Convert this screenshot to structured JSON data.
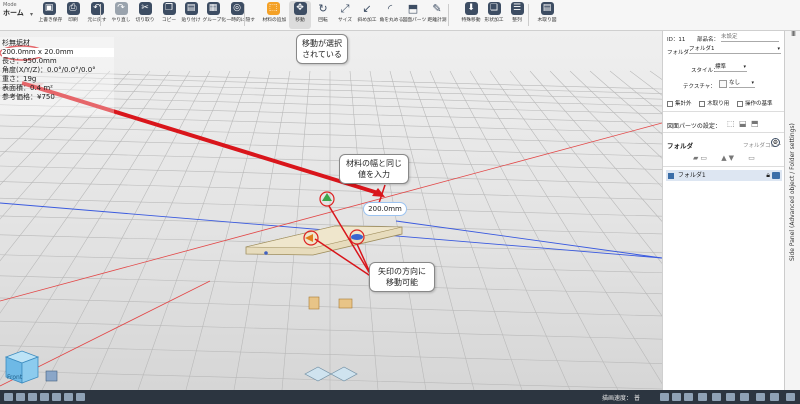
{
  "mode": {
    "caption": "Mode",
    "value": "ホーム"
  },
  "toolbar": {
    "items": [
      {
        "label": "上書き保存",
        "icon": "save-icon",
        "glyph": "▣"
      },
      {
        "label": "印刷",
        "icon": "print-icon",
        "glyph": "⎙"
      },
      {
        "label": "元に戻す",
        "icon": "undo-icon",
        "glyph": "↶"
      },
      {
        "label": "やり直し",
        "icon": "redo-icon",
        "glyph": "↷"
      },
      {
        "label": "切り取り",
        "icon": "cut-icon",
        "glyph": "✂"
      },
      {
        "label": "コピー",
        "icon": "copy-icon",
        "glyph": "❐"
      },
      {
        "label": "貼り付け",
        "icon": "paste-icon",
        "glyph": "▤"
      },
      {
        "label": "グループ化",
        "icon": "group-icon",
        "glyph": "▦"
      },
      {
        "label": "一時的に隠す",
        "icon": "hide-icon",
        "glyph": "◎"
      },
      {
        "label": "材料の追加",
        "icon": "add-material-icon",
        "glyph": "⬚"
      },
      {
        "label": "移動",
        "icon": "move-icon",
        "glyph": "✥"
      },
      {
        "label": "回転",
        "icon": "rotate-icon",
        "glyph": "↻"
      },
      {
        "label": "サイズ",
        "icon": "resize-icon",
        "glyph": "⤢"
      },
      {
        "label": "斜め加工",
        "icon": "bevel-icon",
        "glyph": "↙"
      },
      {
        "label": "角を丸める",
        "icon": "round-corner-icon",
        "glyph": "◜"
      },
      {
        "label": "図面パーツ",
        "icon": "drawing-parts-icon",
        "glyph": "⬒"
      },
      {
        "label": "距離計測",
        "icon": "measure-icon",
        "glyph": "✎"
      },
      {
        "label": "特殊移動",
        "icon": "special-move-icon",
        "glyph": "⬇"
      },
      {
        "label": "形状加工",
        "icon": "shape-process-icon",
        "glyph": "❏"
      },
      {
        "label": "整列",
        "icon": "align-icon",
        "glyph": "☰"
      },
      {
        "label": "木取り図",
        "icon": "cutting-diagram-icon",
        "glyph": "▤"
      }
    ]
  },
  "info": {
    "lines": [
      "杉無垢材",
      "200.0mm x 20.0mm",
      "長さ：950.0mm",
      "角度(X/Y/Z)：0.0°/0.0°/0.0°",
      "重さ：19g",
      "表面積：0.4 m²",
      "参考価格：¥750"
    ]
  },
  "callouts": {
    "move_selected": "移動が選択\nされている",
    "enter_width": "材料の幅と同じ\n値を入力",
    "arrow_direction": "矢印の方向に\n移動可能"
  },
  "dimension_value": "200.0mm",
  "panel": {
    "id_label": "ID：11",
    "part_name_label": "部品名：",
    "part_name_placeholder": "未設定",
    "folder_label": "フォルダ：",
    "folder_value": "フォルダ1",
    "style_label": "スタイル：",
    "style_value": "標準",
    "texture_label": "テクスチャ：",
    "texture_value": "なし",
    "checks": [
      "集計外",
      "木取り用",
      "操作の基準"
    ],
    "drawing_settings_label": "図面パーツの設定：",
    "folder_section_title": "フォルダ",
    "folder_tools_label": "フォルダコピー",
    "folder_items": [
      {
        "name": "フォルダ1",
        "checked": true
      }
    ]
  },
  "side_tab_label": "Side Panel (Advanced object / Folder settings)",
  "status": {
    "display_label": "描画速度：",
    "display_value": "普"
  },
  "view_cube_label": "Front"
}
